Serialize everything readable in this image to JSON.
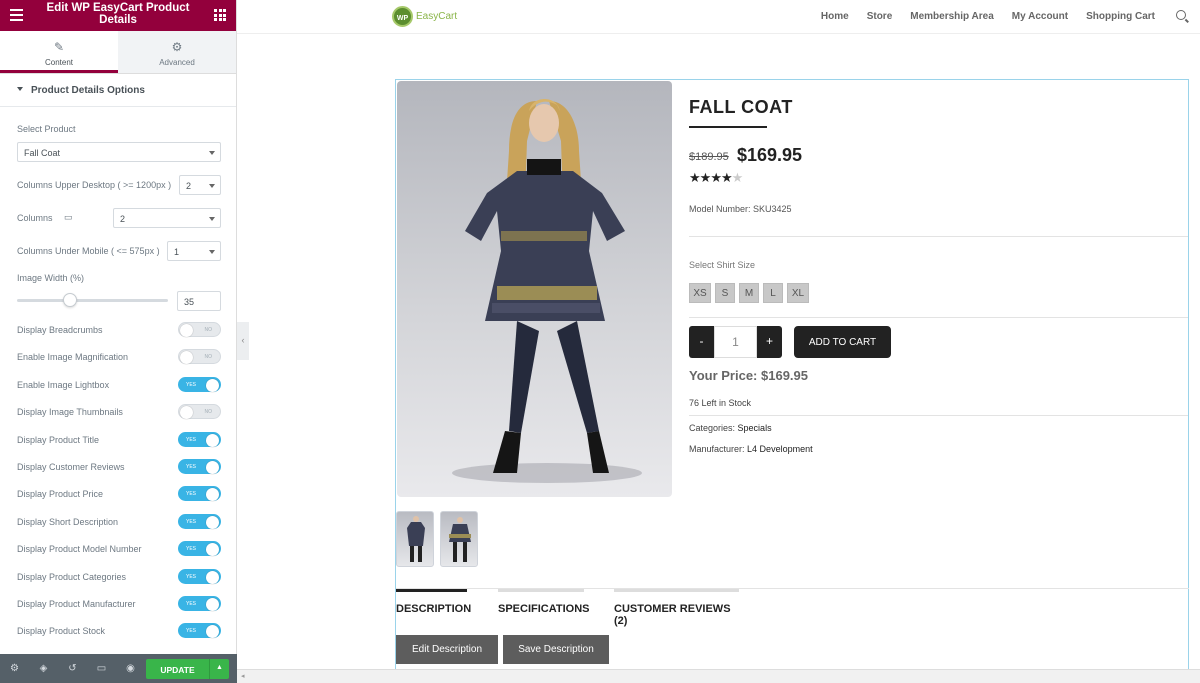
{
  "editor": {
    "title": "Edit WP EasyCart Product Details",
    "tabs": [
      {
        "label": "Content",
        "icon": "pencil-icon"
      },
      {
        "label": "Advanced",
        "icon": "gear-icon"
      }
    ],
    "section_title": "Product Details Options",
    "select_product_label": "Select Product",
    "select_product_value": "Fall Coat",
    "cols_upper_label": "Columns Upper Desktop ( >= 1200px )",
    "cols_upper_value": "2",
    "columns_label": "Columns",
    "columns_value": "2",
    "cols_mobile_label": "Columns Under Mobile ( <= 575px )",
    "cols_mobile_value": "1",
    "image_width_label": "Image Width (%)",
    "image_width_value": "35",
    "image_width_fraction": 0.35,
    "toggle_yes": "YES",
    "toggle_no": "NO",
    "toggles": [
      {
        "label": "Display Breadcrumbs",
        "on": false
      },
      {
        "label": "Enable Image Magnification",
        "on": false
      },
      {
        "label": "Enable Image Lightbox",
        "on": true
      },
      {
        "label": "Display Image Thumbnails",
        "on": false
      },
      {
        "label": "Display Product Title",
        "on": true
      },
      {
        "label": "Display Customer Reviews",
        "on": true
      },
      {
        "label": "Display Product Price",
        "on": true
      },
      {
        "label": "Display Short Description",
        "on": true
      },
      {
        "label": "Display Product Model Number",
        "on": true
      },
      {
        "label": "Display Product Categories",
        "on": true
      },
      {
        "label": "Display Product Manufacturer",
        "on": true
      },
      {
        "label": "Display Product Stock",
        "on": true
      }
    ],
    "update_label": "UPDATE",
    "bottom_icons": [
      "settings-icon",
      "layers-icon",
      "history-icon",
      "responsive-icon",
      "preview-eye-icon"
    ]
  },
  "site": {
    "logo_badge": "WP",
    "logo_text": "EasyCart",
    "menu": [
      "Home",
      "Store",
      "Membership Area",
      "My Account",
      "Shopping Cart"
    ]
  },
  "product": {
    "title": "FALL COAT",
    "old_price": "$189.95",
    "price": "$169.95",
    "rating": 4,
    "rating_max": 5,
    "model": "Model Number: SKU3425",
    "size_label": "Select Shirt Size",
    "sizes": [
      "XS",
      "S",
      "M",
      "L",
      "XL"
    ],
    "qty_minus": "-",
    "qty": "1",
    "qty_plus": "+",
    "add_to_cart": "ADD TO CART",
    "your_price": "Your Price: $169.95",
    "stock": "76 Left in Stock",
    "categories_label": "Categories:",
    "categories_value": "Specials",
    "manufacturer_label": "Manufacturer:",
    "manufacturer_value": "L4 Development",
    "tabs": [
      "DESCRIPTION",
      "SPECIFICATIONS",
      "CUSTOMER REVIEWS (2)"
    ],
    "edit_description": "Edit Description",
    "save_description": "Save Description"
  }
}
